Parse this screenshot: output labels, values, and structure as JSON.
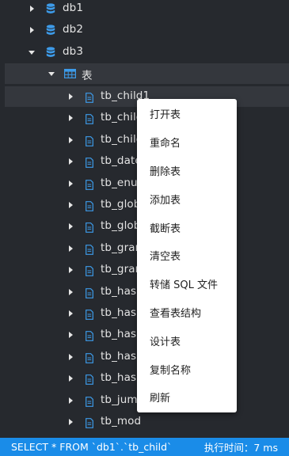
{
  "tree": {
    "databases": [
      {
        "name": "db1",
        "expanded": false
      },
      {
        "name": "db2",
        "expanded": false
      },
      {
        "name": "db3",
        "expanded": true
      }
    ],
    "tables_folder": {
      "label": "表",
      "expanded": true
    },
    "tables": [
      "tb_child1",
      "tb_chilc",
      "tb_chilc",
      "tb_date",
      "tb_enur",
      "tb_glob",
      "tb_glob",
      "tb_grar",
      "tb_grar",
      "tb_hash",
      "tb_hash",
      "tb_hash",
      "tb_hash",
      "tb_hash",
      "tb_jump",
      "tb_mod"
    ]
  },
  "context_menu": {
    "items": [
      "打开表",
      "重命名",
      "删除表",
      "添加表",
      "截断表",
      "清空表",
      "转储 SQL 文件",
      "查看表结构",
      "设计表",
      "复制名称",
      "刷新"
    ]
  },
  "status_bar": {
    "query": "SELECT * FROM `db1`.`tb_child`",
    "exec_time": "执行时间：7 ms"
  },
  "colors": {
    "background": "#26292e",
    "selected_row": "#34373d",
    "accent_blue": "#1a8ce8",
    "icon_blue": "#3d9be9",
    "menu_bg": "#ffffff"
  }
}
